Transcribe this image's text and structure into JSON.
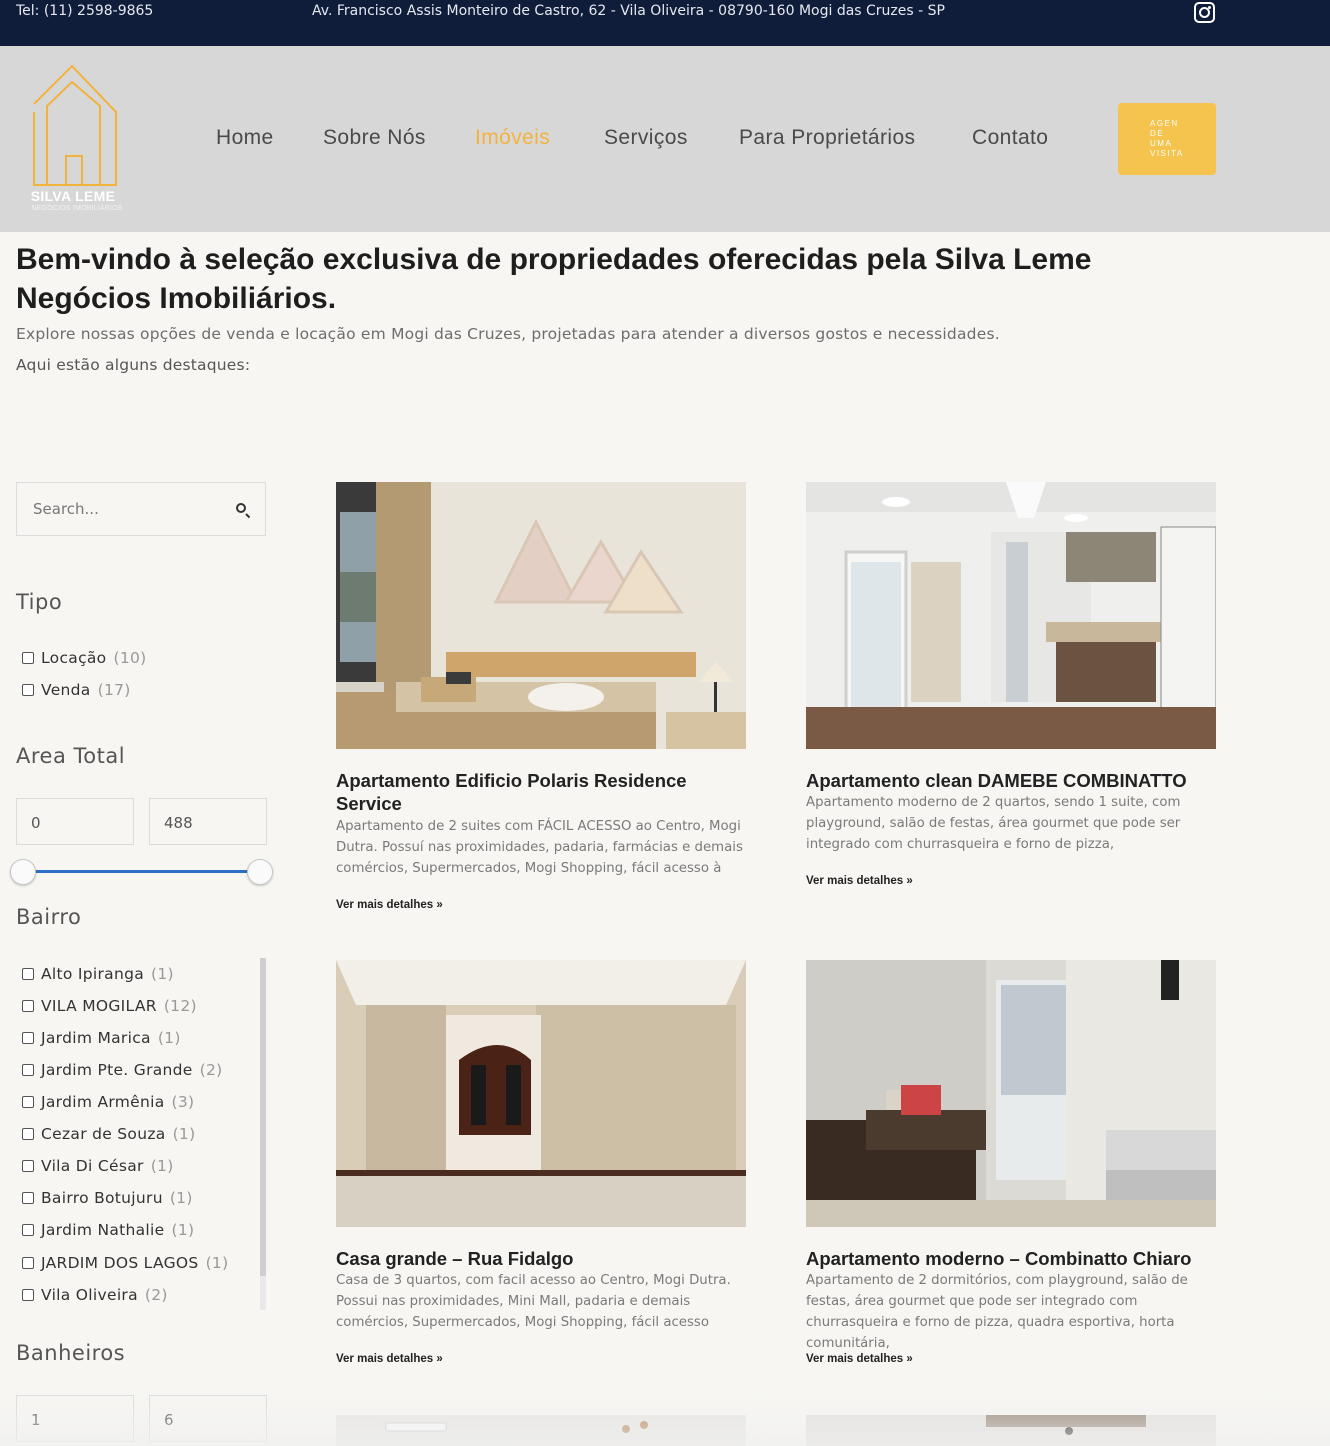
{
  "topbar": {
    "tel": "Tel: (11) 2598-9865",
    "address": "Av. Francisco Assis Monteiro de Castro, 62 - Vila Oliveira - 08790-160 Mogi das Cruzes - SP",
    "instagram_icon": "instagram-icon"
  },
  "header": {
    "logo_name": "SILVA LEME",
    "logo_sub": "NEGÓCIOS IMOBILIÁRIOS",
    "accent": "#f2b33d",
    "nav": [
      {
        "label": "Home"
      },
      {
        "label": "Sobre Nós"
      },
      {
        "label": "Imóveis",
        "active": true
      },
      {
        "label": "Serviços"
      },
      {
        "label": "Para Proprietários"
      },
      {
        "label": "Contato"
      }
    ],
    "cta": "AGEN DE UMA VISITA"
  },
  "intro": {
    "title": "Bem-vindo à seleção exclusiva de propriedades oferecidas pela Silva Leme Negócios Imobiliários.",
    "line1": "Explore nossas opções de venda e locação em Mogi das Cruzes, projetadas para atender a diversos gostos e necessidades.",
    "line2": "Aqui estão alguns destaques:"
  },
  "sidebar": {
    "search_placeholder": "Search...",
    "tipo": {
      "title": "Tipo",
      "items": [
        {
          "label": "Locação",
          "count": "(10)"
        },
        {
          "label": "Venda",
          "count": "(17)"
        }
      ]
    },
    "area": {
      "title": "Area Total",
      "min": "0",
      "max": "488"
    },
    "bairro": {
      "title": "Bairro",
      "items": [
        {
          "label": "Alto Ipiranga",
          "count": "(1)"
        },
        {
          "label": "VILA MOGILAR",
          "count": "(12)"
        },
        {
          "label": "Jardim Marica",
          "count": "(1)"
        },
        {
          "label": "Jardim Pte. Grande",
          "count": "(2)"
        },
        {
          "label": "Jardim Armênia",
          "count": "(3)"
        },
        {
          "label": "Cezar de Souza",
          "count": "(1)"
        },
        {
          "label": "Vila Di César",
          "count": "(1)"
        },
        {
          "label": "Bairro Botujuru",
          "count": "(1)"
        },
        {
          "label": "Jardim Nathalie",
          "count": "(1)"
        },
        {
          "label": "JARDIM DOS LAGOS",
          "count": "(1)"
        },
        {
          "label": "Vila Oliveira",
          "count": "(2)"
        }
      ]
    },
    "banheiros": {
      "title": "Banheiros",
      "min": "1",
      "max": "6"
    }
  },
  "listings": [
    {
      "title": "Apartamento Edificio Polaris Residence Service",
      "desc": "Apartamento de 2 suites com FÁCIL ACESSO ao Centro, Mogi Dutra. Possuí nas proximidades, padaria, farmácias e demais comércios, Supermercados, Mogi Shopping, fácil acesso à",
      "link": "Ver mais detalhes »"
    },
    {
      "title": "Apartamento clean DAMEBE COMBINATTO",
      "desc": "Apartamento moderno de 2 quartos, sendo 1 suite,  com playground, salão de festas, área gourmet  que pode ser integrado com churrasqueira e forno de pizza,",
      "link": "Ver mais detalhes »"
    },
    {
      "title": "Casa grande – Rua Fidalgo",
      "desc": "Casa de 3 quartos, com facil acesso ao Centro, Mogi Dutra. Possui nas proximidades, Mini Mall, padaria e demais comércios, Supermercados, Mogi Shopping, fácil acesso",
      "link": "Ver mais detalhes »"
    },
    {
      "title": "Apartamento moderno – Combinatto Chiaro",
      "desc": "Apartamento de 2 dormitórios, com playground, salão de festas, área gourmet  que pode ser integrado com churrasqueira e forno de pizza,  quadra esportiva, horta comunitária,",
      "link": "Ver mais detalhes »"
    }
  ]
}
